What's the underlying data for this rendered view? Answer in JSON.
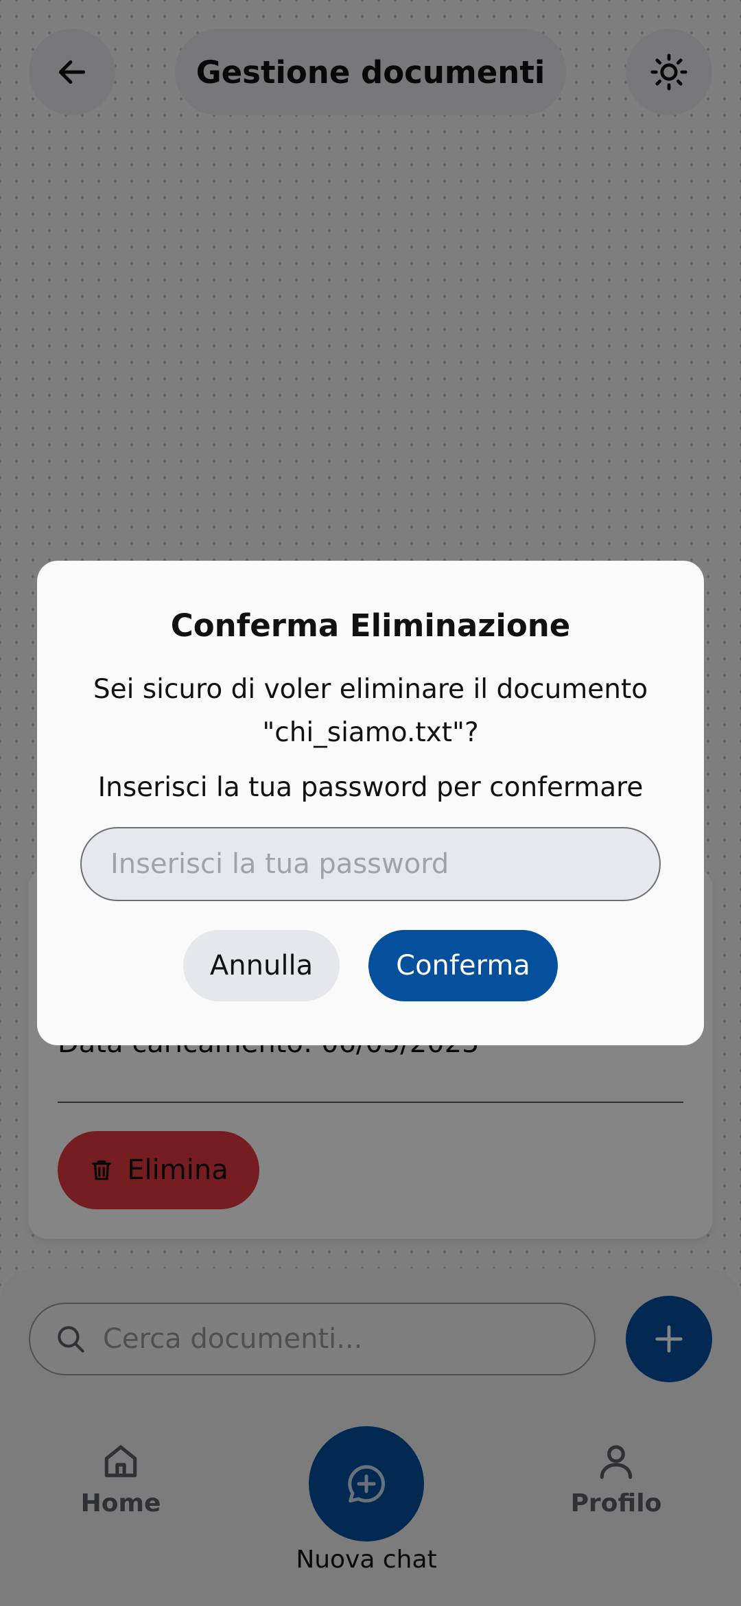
{
  "header": {
    "title": "Gestione documenti",
    "back_icon": "arrow-left-icon",
    "theme_icon": "sun-icon"
  },
  "document_card": {
    "upload_date_label": "Data caricamento: 06/05/2025",
    "delete_label": "Elimina"
  },
  "search": {
    "placeholder": "Cerca documenti..."
  },
  "bottom_nav": {
    "home_label": "Home",
    "new_chat_label": "Nuova chat",
    "profile_label": "Profilo"
  },
  "dialog": {
    "title": "Conferma Eliminazione",
    "message": "Sei sicuro di voler eliminare il documento \"chi_siamo.txt\"?",
    "prompt": "Inserisci la tua password per confermare",
    "password_placeholder": "Inserisci la tua password",
    "cancel_label": "Annulla",
    "confirm_label": "Conferma"
  },
  "colors": {
    "primary": "#04509d",
    "danger": "#e1393f"
  }
}
